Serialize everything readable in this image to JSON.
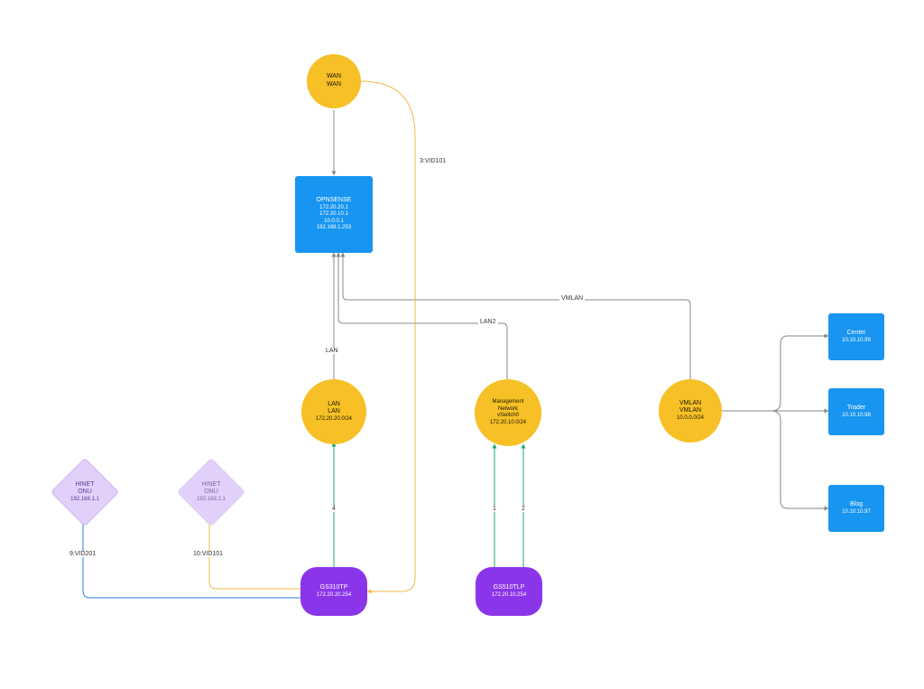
{
  "colors": {
    "yellow": "#f6c026",
    "blue": "#1795f0",
    "purple": "#8b35eb",
    "lilac": "#e2d0fa",
    "edge_gray": "#8a8a8a",
    "edge_orange": "#f6b54a",
    "edge_green": "#1fa864",
    "edge_blue": "#2a7fe0"
  },
  "nodes": {
    "wan": {
      "line1": "WAN",
      "line2": "WAN"
    },
    "opnsense": {
      "title": "OPNSENSE",
      "ips": [
        "172.20.20.1",
        "172.20.10.1",
        "10.0.0.1",
        "192.168.1.253"
      ]
    },
    "lan": {
      "line1": "LAN",
      "line2": "LAN",
      "cidr": "172.20.20.0/24"
    },
    "mgmt": {
      "line1": "Management",
      "line2": "Network",
      "line3": "vSwitch0",
      "cidr": "172.20.10.0/24"
    },
    "vmlan": {
      "line1": "VMLAN",
      "line2": "VMLAN",
      "cidr": "10.0.0.0/24"
    },
    "gs310tp": {
      "name": "GS310TP",
      "ip": "172.20.20.254"
    },
    "gs510tlp": {
      "name": "GS510TLP",
      "ip": "172.20.10.254"
    },
    "hinet_left": {
      "line1": "HINET",
      "line2": "ONU",
      "ip": "192.168.1.1"
    },
    "hinet_right": {
      "line1": "HINET",
      "line2": "ONU",
      "ip": "192.168.1.1"
    },
    "center": {
      "name": "Center",
      "ip": "10.10.10.99"
    },
    "trader": {
      "name": "Trader",
      "ip": "10.10.10.98"
    },
    "blog": {
      "name": "Blog",
      "ip": "10.10.10.97"
    }
  },
  "edges": {
    "wan_to_opnsense": "",
    "opnsense_lan_label": "LAN",
    "opnsense_lan2_label": "LAN2",
    "opnsense_vmlan_label": "VMLAN",
    "wan_vid101_label": "3:VID101",
    "gs310_to_lan_label": "4",
    "gs510_to_mgmt_label_left": "1",
    "gs510_to_mgmt_label_right": "2",
    "gs310_vid201_label": "9:VID201",
    "gs310_vid101_label": "10:VID101"
  }
}
